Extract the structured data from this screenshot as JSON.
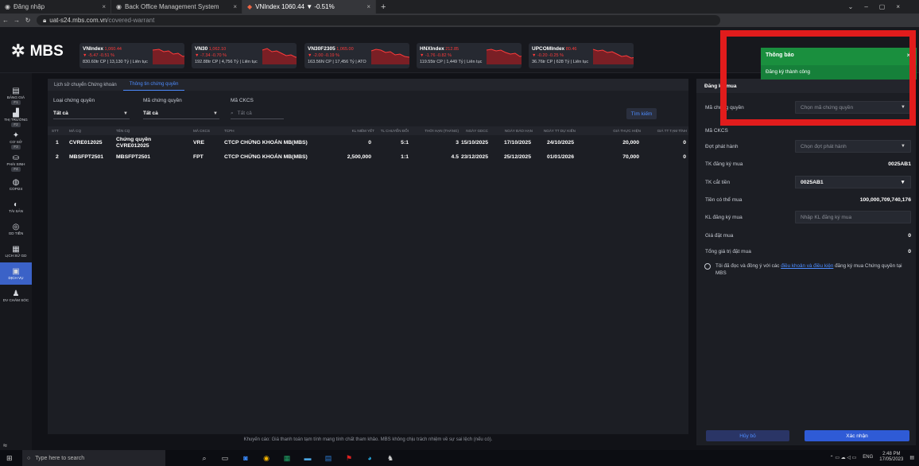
{
  "browser": {
    "tabs": [
      {
        "title": "Đăng nhập",
        "active": false
      },
      {
        "title": "Back Office Management System",
        "active": false
      },
      {
        "title": "VNIndex 1060.44 ▼ -0.51%",
        "active": true
      }
    ],
    "url_host": "uat-s24.mbs.com.vn",
    "url_path": "/covered-warrant"
  },
  "brand": "MBS",
  "tickers": [
    {
      "name": "VNIndex",
      "value": "1,060.44",
      "change": "▼ -5.47 -0.51 %",
      "vol": "830.60tr CP | 13,130 Tỷ | Liên tục"
    },
    {
      "name": "VN30",
      "value": "1,062.10",
      "change": "▼ -7.34 -0.70 %",
      "vol": "192.88tr CP | 4,756 Tỷ | Liên tục"
    },
    {
      "name": "VN30F2305",
      "value": "1,065.00",
      "change": "▼ -2.00 -0.19 %",
      "vol": "163.56N CP | 17,456 Tỷ | ATO"
    },
    {
      "name": "HNXIndex",
      "value": "212.85",
      "change": "▼ -1.76 -0.82 %",
      "vol": "119.55tr CP | 1,449 Tỷ | Liên tục"
    },
    {
      "name": "UPCOMIndex",
      "value": "80.46",
      "change": "▼ -0.20 -0.25 %",
      "vol": "36.76tr CP | 628 Tỷ | Liên tục"
    }
  ],
  "sidebar": [
    {
      "icon": "▤",
      "label": "BẢNG GIÁ",
      "key": "F1"
    },
    {
      "icon": "▟",
      "label": "THỊ TRƯỜNG",
      "key": "F2"
    },
    {
      "icon": "✦",
      "label": "CƠ SỞ",
      "key": "F3"
    },
    {
      "icon": "⛀",
      "label": "PHÁI SINH",
      "key": "F4"
    },
    {
      "icon": "◍",
      "label": "COPI24",
      "key": ""
    },
    {
      "icon": "◐",
      "label": "TÀI SẢN",
      "key": ""
    },
    {
      "icon": "◎",
      "label": "GD TIỀN",
      "key": ""
    },
    {
      "icon": "▦",
      "label": "LỊCH SỬ GD",
      "key": ""
    },
    {
      "icon": "▣",
      "label": "DỊCH VỤ",
      "key": "",
      "active": true
    },
    {
      "icon": "♟",
      "label": "DV CHĂM SÓC",
      "key": ""
    }
  ],
  "sidebar_collapse": "≈",
  "subtabs": [
    {
      "label": "Lịch sử chuyển Chứng khoán",
      "active": false
    },
    {
      "label": "Thông tin chứng quyền",
      "active": true
    }
  ],
  "filters": {
    "type_label": "Loại chứng quyền",
    "type_value": "Tất cả",
    "code_label": "Mã chứng quyền",
    "code_value": "Tất cả",
    "cksc_label": "Mã CKCS",
    "cksc_placeholder": "Tất cả",
    "search_button": "Tìm kiếm"
  },
  "table": {
    "headers": [
      "STT",
      "MÃ CQ",
      "TÊN CQ",
      "MÃ CKCS",
      "TCPH",
      "KL NIÊM YẾT",
      "TL CHUYỂN ĐỔI",
      "THỜI HẠN (THÁNG)",
      "NGÀY GDCC",
      "NGÀY ĐÁO HẠN",
      "NGÀY TT DỰ KIẾN",
      "GIÁ THỰC HIỆN",
      "GIÁ TT TẠM TÍNH"
    ],
    "rows": [
      [
        "1",
        "CVRE012025",
        "Chứng quyền CVRE012025",
        "VRE",
        "CTCP CHỨNG KHOÁN MB(MBS)",
        "0",
        "5:1",
        "3",
        "15/10/2025",
        "17/10/2025",
        "24/10/2025",
        "20,000",
        "0"
      ],
      [
        "2",
        "MBSFPT2501",
        "MBSFPT2501",
        "FPT",
        "CTCP CHỨNG KHOÁN MB(MBS)",
        "2,500,000",
        "1:1",
        "4.5",
        "23/12/2025",
        "25/12/2025",
        "01/01/2026",
        "70,000",
        "0"
      ]
    ]
  },
  "disclaimer": "Khuyến cáo: Giá thanh toán tạm tính mang tính chất tham khảo. MBS không chịu trách nhiệm về sự sai lệch (nếu có).",
  "form": {
    "title": "Đăng ký mua",
    "warrant_label": "Mã chứng quyền",
    "warrant_placeholder": "Chọn mã chứng quyền",
    "cksc_label": "Mã CKCS",
    "issue_label": "Đợt phát hành",
    "issue_placeholder": "Chọn đợt phát hành",
    "reg_account_label": "TK đăng ký mua",
    "reg_account_value": "0025AB1",
    "debit_account_label": "TK cắt tiền",
    "debit_account_value": "0025AB1",
    "available_cash_label": "Tiền có thể mua",
    "available_cash_value": "100,000,709,740,176",
    "qty_label": "KL đăng ký mua",
    "qty_placeholder": "Nhập KL đăng ký mua",
    "price_label": "Giá đặt mua",
    "price_value": "0",
    "total_label": "Tổng giá trị đặt mua",
    "total_value": "0",
    "terms_prefix": "Tôi đã đọc và đồng ý với các ",
    "terms_link": "điều khoản và điều kiện",
    "terms_suffix": " đăng ký mua Chứng quyền tại MBS",
    "cancel": "Hủy bỏ",
    "confirm": "Xác nhận"
  },
  "toast": {
    "title": "Thông báo",
    "message": "Đăng ký thành công",
    "close": "×"
  },
  "taskbar": {
    "search_placeholder": "Type here to search",
    "lang": "ENG",
    "time": "2:48 PM",
    "date": "17/05/2023"
  }
}
